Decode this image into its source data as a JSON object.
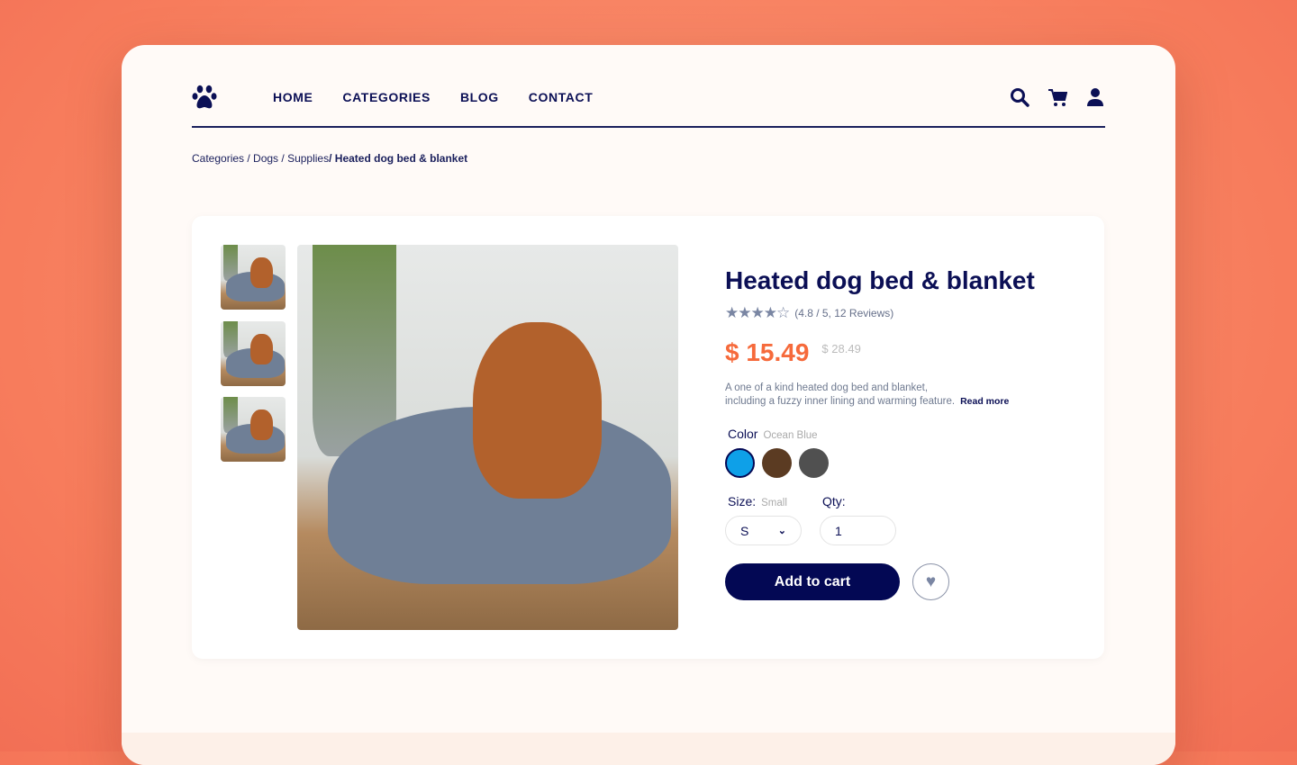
{
  "nav": {
    "logo": "paw-logo",
    "links": [
      "HOME",
      "CATEGORIES",
      "BLOG",
      "CONTACT"
    ],
    "icons": [
      "search-icon",
      "cart-icon",
      "user-icon"
    ]
  },
  "breadcrumb": {
    "items": [
      "Categories",
      "Dogs",
      "Supplies"
    ],
    "current": "Heated dog bed & blanket"
  },
  "product": {
    "title": "Heated dog bed & blanket",
    "stars": "★★★★☆",
    "rating_text": "(4.8 / 5, 12 Reviews)",
    "rating": 4.8,
    "price": "$ 15.49",
    "old_price": "$ 28.49",
    "description_line1": "A one of a kind heated dog bed and blanket,",
    "description_line2": "including a fuzzy inner lining and warming feature.",
    "read_more": "Read more",
    "color_label": "Color",
    "color_value": "Ocean Blue",
    "colors": [
      "#0ea0e8",
      "#5b3b22",
      "#505050"
    ],
    "size_label": "Size:",
    "size_value": "Small",
    "size_selected": "S",
    "qty_label": "Qty:",
    "qty_value": "1",
    "add_to_cart": "Add to cart"
  },
  "colors": {
    "accent": "#f66a3b",
    "brand": "#030854"
  }
}
